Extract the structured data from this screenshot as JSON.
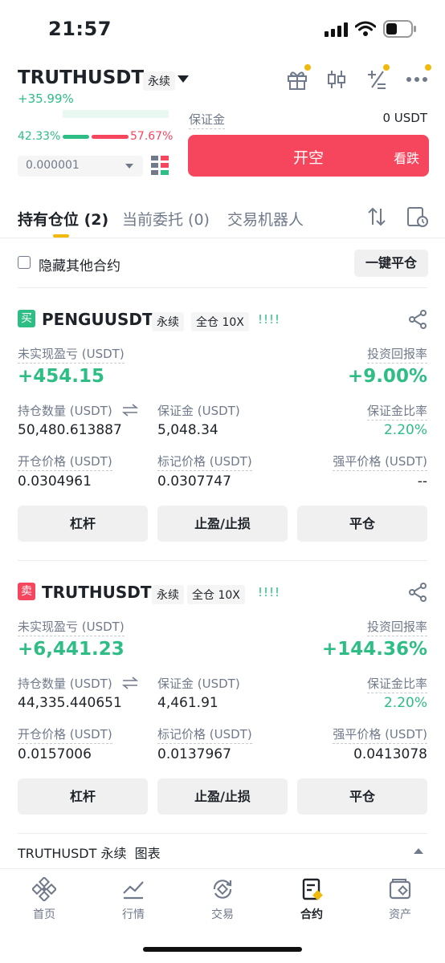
{
  "status_bar": {
    "time": "21:57"
  },
  "header": {
    "symbol": "TRUTHUSDT",
    "contract_type": "永续",
    "change": "+35.99%",
    "icons": [
      "gift-icon",
      "candlestick-icon",
      "calculator-icon",
      "more-icon"
    ]
  },
  "order_panel": {
    "buy_ratio": "42.33%",
    "sell_ratio": "57.67%",
    "buy_fraction": 0.4233,
    "precision_value": "0.000001",
    "margin_label": "保证金",
    "margin_value": "0 USDT",
    "short_button": {
      "label": "开空",
      "sub": "看跌"
    }
  },
  "tabs": [
    {
      "label": "持有仓位 (2)"
    },
    {
      "label": "当前委托 (0)"
    },
    {
      "label": "交易机器人"
    }
  ],
  "filter": {
    "hide_other_label": "隐藏其他合约",
    "close_all_label": "一键平仓"
  },
  "positions": [
    {
      "side": "买",
      "symbol": "PENGUUSDT",
      "type_tag": "永续",
      "margin_tag": "全仓 10X",
      "signal": "!!!!",
      "unrealized_pnl_label": "未实现盈亏 (USDT)",
      "unrealized_pnl": "+454.15",
      "roe_label": "投资回报率",
      "roe": "+9.00%",
      "size_label": "持仓数量 (USDT)",
      "size": "50,480.613887",
      "margin_label": "保证金 (USDT)",
      "margin": "5,048.34",
      "margin_ratio_label": "保证金比率",
      "margin_ratio": "2.20%",
      "entry_label": "开仓价格 (USDT)",
      "entry": "0.0304961",
      "mark_label": "标记价格 (USDT)",
      "mark": "0.0307747",
      "liq_label": "强平价格 (USDT)",
      "liq": "--",
      "buttons": [
        "杠杆",
        "止盈/止损",
        "平仓"
      ]
    },
    {
      "side": "卖",
      "symbol": "TRUTHUSDT",
      "type_tag": "永续",
      "margin_tag": "全仓 10X",
      "signal": "!!!!",
      "unrealized_pnl_label": "未实现盈亏 (USDT)",
      "unrealized_pnl": "+6,441.23",
      "roe_label": "投资回报率",
      "roe": "+144.36%",
      "size_label": "持仓数量 (USDT)",
      "size": "44,335.440651",
      "margin_label": "保证金 (USDT)",
      "margin": "4,461.91",
      "margin_ratio_label": "保证金比率",
      "margin_ratio": "2.20%",
      "entry_label": "开仓价格 (USDT)",
      "entry": "0.0157006",
      "mark_label": "标记价格 (USDT)",
      "mark": "0.0137967",
      "liq_label": "强平价格 (USDT)",
      "liq": "0.0413078",
      "buttons": [
        "杠杆",
        "止盈/止损",
        "平仓"
      ]
    }
  ],
  "chart_row": {
    "label": "TRUTHUSDT 永续  图表"
  },
  "bottom_nav": [
    {
      "label": "首页",
      "icon": "home-icon"
    },
    {
      "label": "行情",
      "icon": "markets-icon"
    },
    {
      "label": "交易",
      "icon": "trade-icon"
    },
    {
      "label": "合约",
      "icon": "futures-icon",
      "active": true
    },
    {
      "label": "资产",
      "icon": "wallet-icon"
    }
  ],
  "colors": {
    "green": "#2ebd85",
    "red": "#f6465d",
    "brand_yellow": "#f0b90b"
  }
}
